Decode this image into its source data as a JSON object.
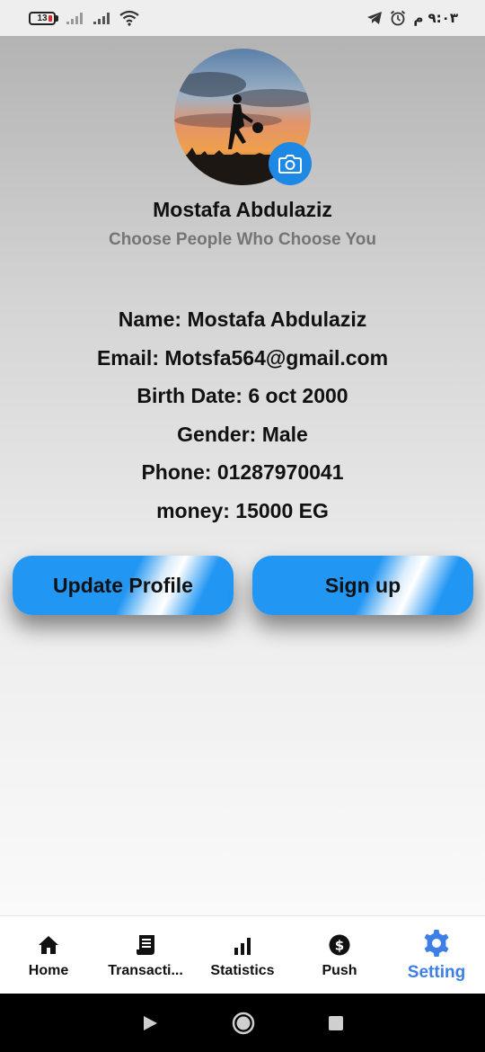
{
  "status_bar": {
    "battery": "13",
    "time": "٩:٠٣ م"
  },
  "profile": {
    "name": "Mostafa Abdulaziz",
    "tagline": "Choose People Who Choose You"
  },
  "info": [
    {
      "label": "Name: ",
      "value": "Mostafa Abdulaziz"
    },
    {
      "label": "Email: ",
      "value": "Motsfa564@gmail.com"
    },
    {
      "label": "Birth Date: ",
      "value": "6 oct 2000"
    },
    {
      "label": "Gender: ",
      "value": "Male"
    },
    {
      "label": "Phone: ",
      "value": "01287970041"
    },
    {
      "label": "money: ",
      "value": "15000 EG"
    }
  ],
  "buttons": {
    "update_label": "Update Profile",
    "signup_label": "Sign up"
  },
  "bottom_nav": {
    "items": [
      {
        "label": "Home",
        "icon": "home-icon"
      },
      {
        "label": "Transacti...",
        "icon": "receipt-icon"
      },
      {
        "label": "Statistics",
        "icon": "bar-chart-icon"
      },
      {
        "label": "Push",
        "icon": "dollar-icon"
      },
      {
        "label": "Setting",
        "icon": "gear-icon"
      }
    ],
    "active": "Setting",
    "active_color": "#3d7fe6"
  },
  "colors": {
    "accent": "#2196f3",
    "camera_button": "#1e88e5"
  }
}
